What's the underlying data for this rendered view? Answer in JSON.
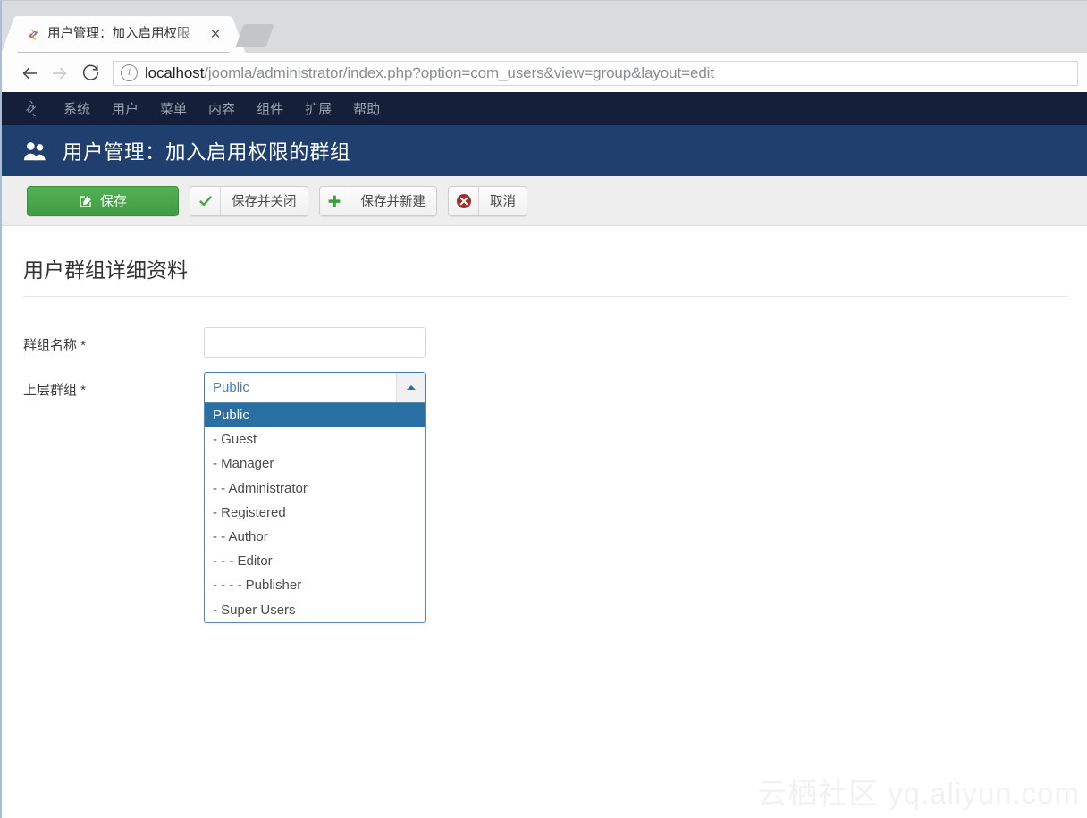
{
  "browser": {
    "tab": {
      "title": "用户管理：加入启用权限",
      "favicon": "joomla-favicon",
      "close_label": "✕"
    },
    "newtab_label": "",
    "nav": {
      "back": "←",
      "forward": "→",
      "reload": "⟳",
      "info_glyph": "i"
    },
    "url": {
      "host": "localhost",
      "path": "/joomla/administrator/index.php?option=com_users&view=group&layout=edit",
      "full": "localhost/joomla/administrator/index.php?option=com_users&view=group&layout=edit"
    }
  },
  "admin": {
    "menubar": {
      "logo": "joomla-logo",
      "items": [
        {
          "label": "系统"
        },
        {
          "label": "用户"
        },
        {
          "label": "菜单"
        },
        {
          "label": "内容"
        },
        {
          "label": "组件"
        },
        {
          "label": "扩展"
        },
        {
          "label": "帮助"
        }
      ]
    },
    "header": {
      "icon": "users-icon",
      "title": "用户管理：加入启用权限的群组"
    },
    "toolbar": {
      "save_label": "保存",
      "save_close_label": "保存并关闭",
      "save_new_label": "保存并新建",
      "cancel_label": "取消"
    },
    "form": {
      "section_title": "用户群组详细资料",
      "group_name": {
        "label": "群组名称 *",
        "value": "",
        "placeholder": ""
      },
      "parent_group": {
        "label": "上层群组 *",
        "selected": "Public",
        "expanded": true,
        "options": [
          {
            "label": "Public",
            "selected": true
          },
          {
            "label": "- Guest",
            "selected": false
          },
          {
            "label": "- Manager",
            "selected": false
          },
          {
            "label": "- - Administrator",
            "selected": false
          },
          {
            "label": "- Registered",
            "selected": false
          },
          {
            "label": "- - Author",
            "selected": false
          },
          {
            "label": "- - - Editor",
            "selected": false
          },
          {
            "label": "- - - - Publisher",
            "selected": false
          },
          {
            "label": "- Super Users",
            "selected": false
          }
        ]
      }
    }
  },
  "watermark": "云栖社区 yq.aliyun.com",
  "colors": {
    "menubar_bg": "#14203a",
    "header_bg": "#1f406e",
    "toolbar_bg": "#eeeeee",
    "save_green": "#46a546",
    "cancel_red": "#a32d2d",
    "select_highlight": "#2a6fa3",
    "select_border": "#3f7fb5",
    "link_blue": "#4a7fae"
  }
}
